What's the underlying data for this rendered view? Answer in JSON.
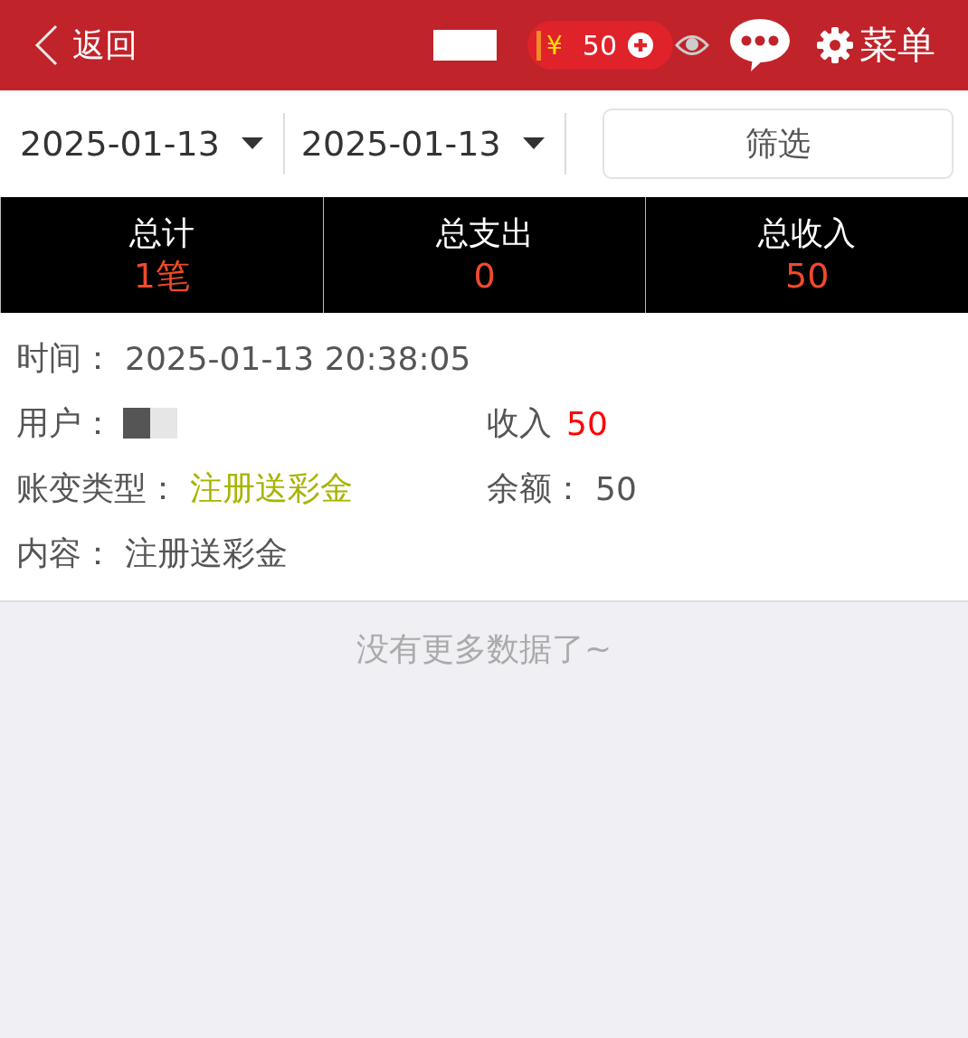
{
  "header": {
    "back": "返回",
    "balance_symbol": "¥",
    "balance": "50",
    "menu": "菜单"
  },
  "filter": {
    "start_date": "2025-01-13",
    "end_date": "2025-01-13",
    "button": "筛选"
  },
  "summary": [
    {
      "label": "总计",
      "value": "1笔"
    },
    {
      "label": "总支出",
      "value": "0"
    },
    {
      "label": "总收入",
      "value": "50"
    }
  ],
  "record": {
    "time_label": "时间：",
    "time": "2025-01-13 20:38:05",
    "user_label": "用户：",
    "income_label": "收入",
    "income": "50",
    "type_label": "账变类型：",
    "type": "注册送彩金",
    "balance_label": "余额：",
    "balance": "50",
    "content_label": "内容：",
    "content": "注册送彩金"
  },
  "footer": "没有更多数据了~"
}
